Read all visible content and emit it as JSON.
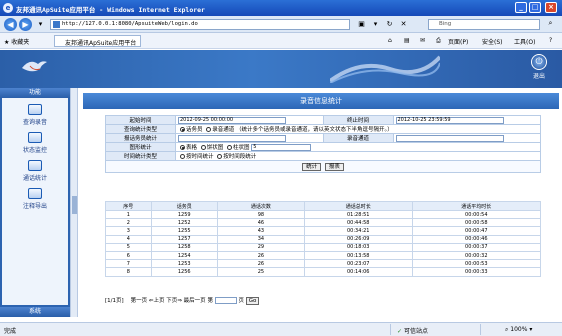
{
  "browser": {
    "title": "友邦通讯ApSuite应用平台 - Windows Internet Explorer",
    "address": "http://127.0.0.1:8080/ApsuiteWeb/login.do",
    "search_placeholder": "Bing",
    "favorites_label": "收藏夹",
    "tab_label": "友邦通讯ApSuite应用平台",
    "tools": [
      "页面(P)",
      "安全(S)",
      "工具(O)"
    ],
    "status_left": "完成",
    "status_zone": "可信站点",
    "status_zoom": "100%"
  },
  "banner": {
    "exit_label": "退出"
  },
  "sidebar": {
    "header": "功能",
    "items": [
      {
        "label": "查询录音",
        "icon": "record-query-icon"
      },
      {
        "label": "状态监控",
        "icon": "monitor-icon"
      },
      {
        "label": "通话统计",
        "icon": "statistics-icon"
      },
      {
        "label": "注释导出",
        "icon": "export-icon"
      }
    ],
    "footer": "系统"
  },
  "page": {
    "title": "录音信息统计",
    "form": {
      "start_label": "起始时间",
      "start_value": "2012-09-25 00:00:00",
      "end_label": "终止时间",
      "end_value": "2012-10-25 23:59:59",
      "query_type_label": "查询统计类型",
      "query_opt1": "话务员",
      "query_opt2": "录音通道",
      "query_hint": "（统计多个话务员或录音通道，请以英文状态下半角逗号隔开。）",
      "agent_label": "报话务员统计",
      "channel_label": "录音通道",
      "chart_label": "图形统计",
      "chart_opt1": "表格",
      "chart_opt2": "饼状图",
      "chart_opt3": "柱状图",
      "chart_num": "5",
      "time_type_label": "时间统计类型",
      "time_opt1": "按时间统计",
      "time_opt2": "按时间段统计",
      "btn_stat": "统计",
      "btn_report": "报表"
    },
    "grid": {
      "headers": [
        "序号",
        "话务员",
        "通话次数",
        "通话总时长",
        "通话平均时长"
      ],
      "rows": [
        [
          "1",
          "1259",
          "98",
          "01:28:51",
          "00:00:54"
        ],
        [
          "2",
          "1252",
          "46",
          "00:44:58",
          "00:00:58"
        ],
        [
          "3",
          "1255",
          "43",
          "00:34:21",
          "00:00:47"
        ],
        [
          "4",
          "1257",
          "34",
          "00:26:09",
          "00:00:46"
        ],
        [
          "5",
          "1258",
          "29",
          "00:18:03",
          "00:00:37"
        ],
        [
          "6",
          "1254",
          "26",
          "00:13:58",
          "00:00:32"
        ],
        [
          "7",
          "1253",
          "26",
          "00:23:07",
          "00:00:53"
        ],
        [
          "8",
          "1256",
          "25",
          "00:14:06",
          "00:00:33"
        ]
      ]
    },
    "pager": {
      "info": "[1/1页]",
      "first": "第一页",
      "prev": "上页",
      "next": "下页",
      "last": "最后一页",
      "goto_prefix": "第",
      "goto_suffix": "页",
      "go": "Go"
    }
  }
}
